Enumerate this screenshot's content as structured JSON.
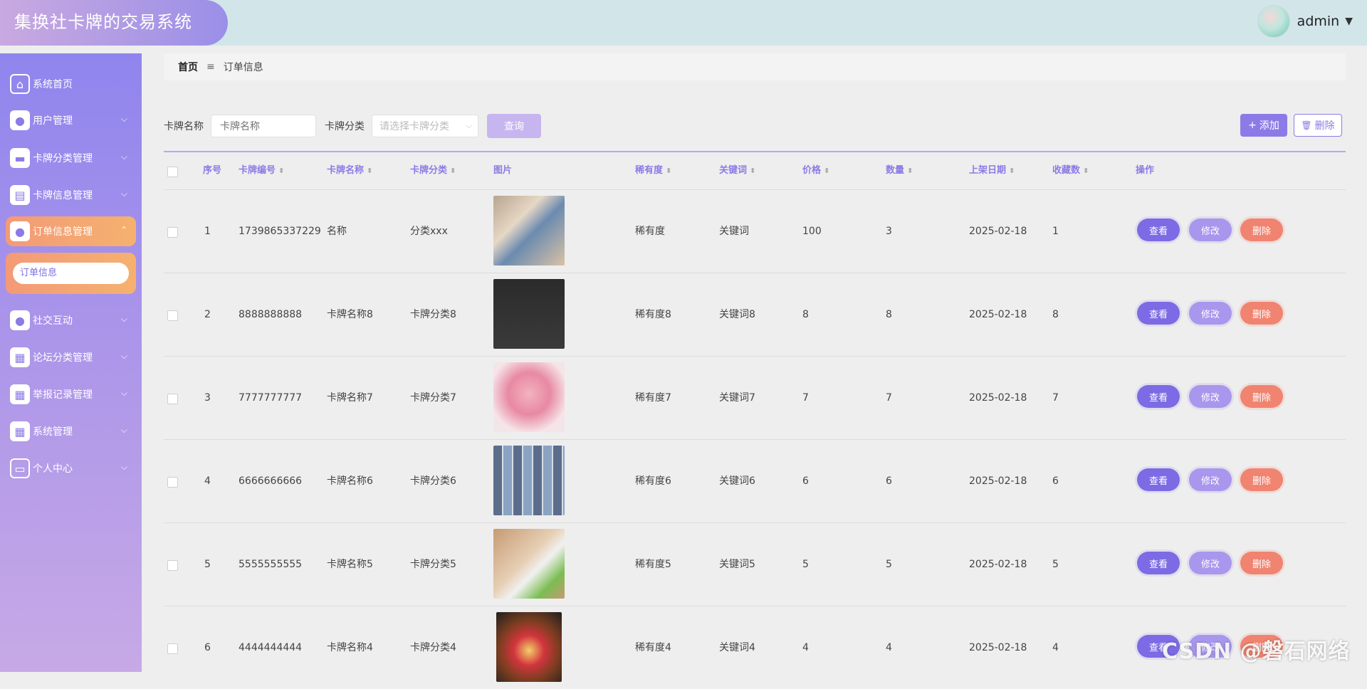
{
  "app": {
    "title": "集换社卡牌的交易系统"
  },
  "user": {
    "name": "admin"
  },
  "sidebar": {
    "items": [
      {
        "label": "系统首页",
        "icon": "home-icon"
      },
      {
        "label": "用户管理",
        "icon": "user-icon"
      },
      {
        "label": "卡牌分类管理",
        "icon": "briefcase-icon"
      },
      {
        "label": "卡牌信息管理",
        "icon": "clipboard-icon"
      },
      {
        "label": "订单信息管理",
        "icon": "bulb-icon"
      },
      {
        "label": "社交互动",
        "icon": "user-icon"
      },
      {
        "label": "论坛分类管理",
        "icon": "grid-icon"
      },
      {
        "label": "举报记录管理",
        "icon": "grid-icon"
      },
      {
        "label": "系统管理",
        "icon": "grid-icon"
      },
      {
        "label": "个人中心",
        "icon": "window-icon"
      }
    ],
    "sub_item": "订单信息"
  },
  "breadcrumb": {
    "home": "首页",
    "separator": "≡",
    "current": "订单信息"
  },
  "search": {
    "name_label": "卡牌名称",
    "name_placeholder": "卡牌名称",
    "category_label": "卡牌分类",
    "category_placeholder": "请选择卡牌分类",
    "query_label": "查询"
  },
  "toolbar": {
    "add_label": "添加",
    "delete_label": "删除"
  },
  "table": {
    "headers": {
      "index": "序号",
      "code": "卡牌编号",
      "name": "卡牌名称",
      "category": "卡牌分类",
      "image": "图片",
      "rarity": "稀有度",
      "keyword": "关键词",
      "price": "价格",
      "quantity": "数量",
      "date": "上架日期",
      "favorites": "收藏数",
      "ops": "操作"
    },
    "rows": [
      {
        "index": "1",
        "code": "1739865337229",
        "name": "名称",
        "category": "分类xxx",
        "rarity": "稀有度",
        "keyword": "关键词",
        "price": "100",
        "quantity": "3",
        "date": "2025-02-18",
        "favorites": "1"
      },
      {
        "index": "2",
        "code": "8888888888",
        "name": "卡牌名称8",
        "category": "卡牌分类8",
        "rarity": "稀有度8",
        "keyword": "关键词8",
        "price": "8",
        "quantity": "8",
        "date": "2025-02-18",
        "favorites": "8"
      },
      {
        "index": "3",
        "code": "7777777777",
        "name": "卡牌名称7",
        "category": "卡牌分类7",
        "rarity": "稀有度7",
        "keyword": "关键词7",
        "price": "7",
        "quantity": "7",
        "date": "2025-02-18",
        "favorites": "7"
      },
      {
        "index": "4",
        "code": "6666666666",
        "name": "卡牌名称6",
        "category": "卡牌分类6",
        "rarity": "稀有度6",
        "keyword": "关键词6",
        "price": "6",
        "quantity": "6",
        "date": "2025-02-18",
        "favorites": "6"
      },
      {
        "index": "5",
        "code": "5555555555",
        "name": "卡牌名称5",
        "category": "卡牌分类5",
        "rarity": "稀有度5",
        "keyword": "关键词5",
        "price": "5",
        "quantity": "5",
        "date": "2025-02-18",
        "favorites": "5"
      },
      {
        "index": "6",
        "code": "4444444444",
        "name": "卡牌名称4",
        "category": "卡牌分类4",
        "rarity": "稀有度4",
        "keyword": "关键词4",
        "price": "4",
        "quantity": "4",
        "date": "2025-02-18",
        "favorites": "4"
      }
    ],
    "actions": {
      "view": "查看",
      "edit": "修改",
      "delete": "删除"
    }
  },
  "watermark": "CSDN @磐石网络",
  "colors": {
    "accent": "#8c7be6",
    "danger": "#f08470",
    "active_menu": "#f39a77"
  }
}
